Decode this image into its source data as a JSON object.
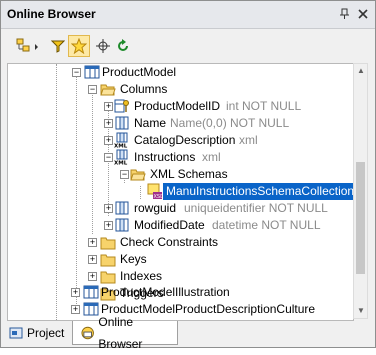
{
  "window": {
    "title": "Online Browser"
  },
  "tree": {
    "rows": [
      {
        "label": "ProductModel",
        "meta": ""
      },
      {
        "label": "Columns",
        "meta": ""
      },
      {
        "label": "ProductModelID",
        "meta": "int NOT NULL"
      },
      {
        "label": "Name",
        "meta": "Name(0,0) NOT NULL"
      },
      {
        "label": "CatalogDescription",
        "meta": "xml"
      },
      {
        "label": "Instructions",
        "meta": "xml"
      },
      {
        "label": "XML Schemas",
        "meta": ""
      },
      {
        "label": "ManuInstructionsSchemaCollection",
        "meta": ""
      },
      {
        "label": "rowguid",
        "meta": "uniqueidentifier NOT NULL"
      },
      {
        "label": "ModifiedDate",
        "meta": "datetime NOT NULL"
      },
      {
        "label": "Check Constraints",
        "meta": ""
      },
      {
        "label": "Keys",
        "meta": ""
      },
      {
        "label": "Indexes",
        "meta": ""
      },
      {
        "label": "Triggers",
        "meta": ""
      },
      {
        "label": "ProductModelIllustration",
        "meta": ""
      },
      {
        "label": "ProductModelProductDescriptionCulture",
        "meta": ""
      }
    ]
  },
  "tabs": [
    {
      "label": "Project"
    },
    {
      "label": "Online Browser"
    }
  ],
  "icons": {
    "pin": "pin-icon",
    "close": "close-icon",
    "layout": "layout-icon",
    "filter": "filter-icon",
    "favorites": "favorites-icon",
    "locate": "locate-icon",
    "refresh": "refresh-icon"
  }
}
